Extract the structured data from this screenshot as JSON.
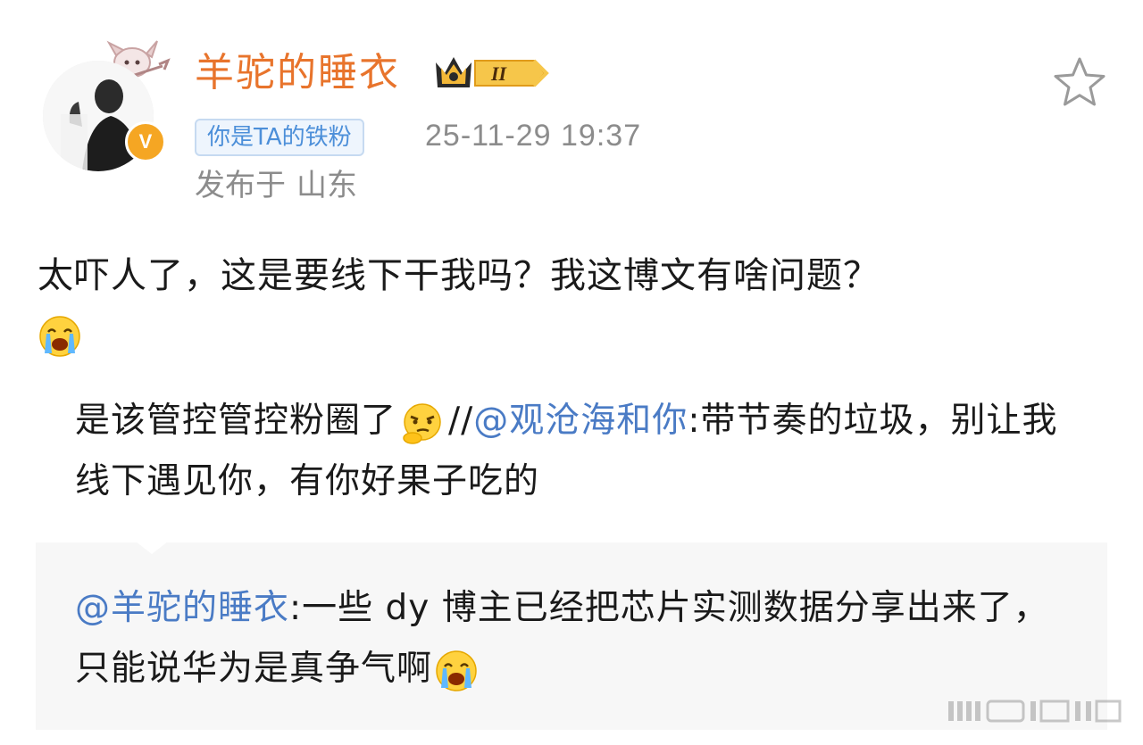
{
  "post": {
    "author": {
      "name": "羊驼的睡衣",
      "verified_badge": "V",
      "fan_tag": "你是TA的铁粉",
      "vip_level": "II"
    },
    "timestamp": "25-11-29 19:37",
    "location_label": "发布于",
    "location": "山东",
    "body": "太吓人了，这是要线下干我吗？我这博文有啥问题？",
    "body_emoji": "crying-emoji",
    "repost_text": "是该管控管控粉圈了",
    "repost_emoji": "thinking-emoji",
    "repost_separator": "//",
    "repost_mention": "@观沧海和你",
    "repost_mention_text": ":带节奏的垃圾，别让我线下遇见你，有你好果子吃的",
    "quoted": {
      "mention": "@羊驼的睡衣",
      "text": ":一些 dy 博主已经把芯片实测数据分享出来了，只能说华为是真争气啊",
      "emoji": "crying-emoji"
    }
  },
  "colors": {
    "username": "#e8742c",
    "mention": "#4a7bc5",
    "meta_gray": "#8c8c8c",
    "fan_tag_blue": "#4c8fd9",
    "verified_orange": "#f5a623",
    "quoted_bg": "#f7f7f7"
  },
  "icons": {
    "favorite": "star-outline-icon",
    "vip": "crown-icon"
  }
}
